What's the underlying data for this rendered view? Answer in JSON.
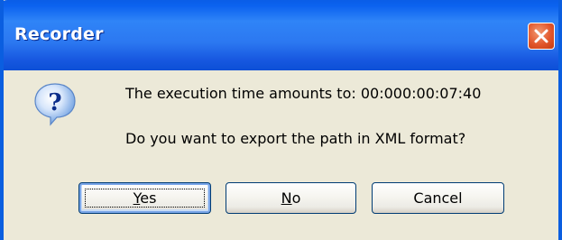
{
  "window": {
    "title": "Recorder"
  },
  "dialog": {
    "icon": "question-icon",
    "message_line1": "The execution time amounts to: 00:000:00:07:40",
    "message_line2": "Do you want to export the path in XML format?"
  },
  "buttons": {
    "yes": {
      "mnemonic": "Y",
      "rest": "es"
    },
    "no": {
      "mnemonic": "N",
      "rest": "o"
    },
    "cancel": {
      "label": "Cancel"
    }
  },
  "colors": {
    "titlebar": "#2c78f1",
    "close": "#e2562b",
    "dialog_bg": "#ece9d8"
  }
}
